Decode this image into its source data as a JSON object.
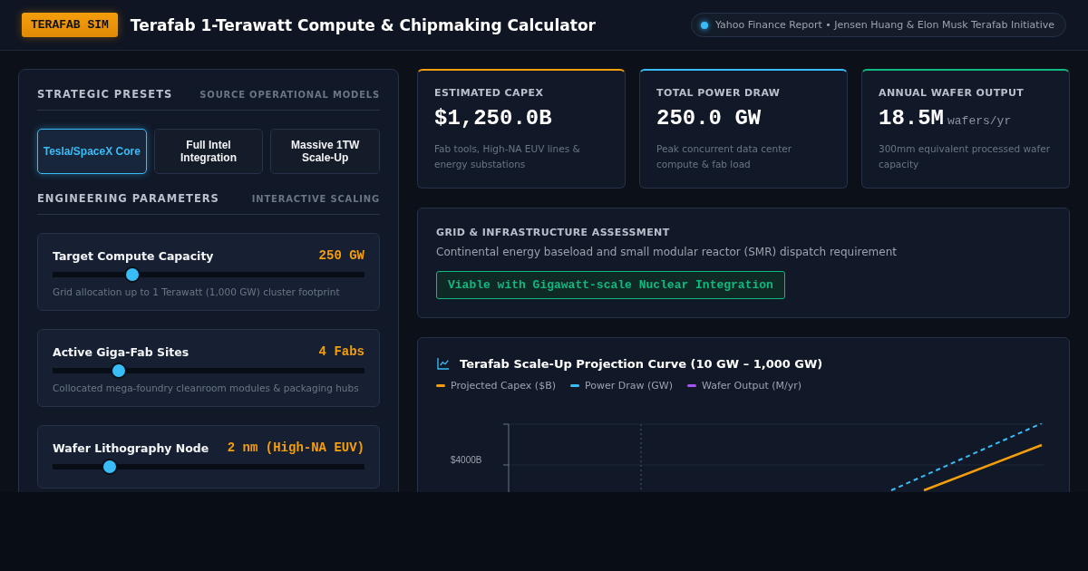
{
  "header": {
    "badge": "TERAFAB SIM",
    "title": "Terafab 1-Terawatt Compute & Chipmaking Calculator",
    "source": "Yahoo Finance Report • Jensen Huang & Elon Musk Terafab Initiative"
  },
  "presets": {
    "title": "STRATEGIC PRESETS",
    "subtitle": "SOURCE OPERATIONAL MODELS",
    "items": [
      {
        "label": "Tesla/SpaceX Core",
        "selected": true
      },
      {
        "label": "Full Intel Integration",
        "selected": false
      },
      {
        "label": "Massive 1TW Scale-Up",
        "selected": false
      }
    ]
  },
  "parameters": {
    "title": "ENGINEERING PARAMETERS",
    "subtitle": "INTERACTIVE SCALING",
    "items": [
      {
        "label": "Target Compute Capacity",
        "value": "250 GW",
        "level": 0.256,
        "hint": "Grid allocation up to 1 Terawatt (1,000 GW) cluster footprint"
      },
      {
        "label": "Active Giga-Fab Sites",
        "value": "4 Fabs",
        "level": 0.212,
        "hint": "Collocated mega-foundry cleanroom modules & packaging hubs"
      },
      {
        "label": "Wafer Lithography Node",
        "value": "2 nm (High-NA EUV)",
        "level": 0.183
      }
    ]
  },
  "metrics": [
    {
      "label": "ESTIMATED CAPEX",
      "value": "$1,250.0B",
      "color": "#f59e0b",
      "note": "Fab tools, High-NA EUV lines & energy substations"
    },
    {
      "label": "TOTAL POWER DRAW",
      "value": "250.0 GW",
      "color": "#38bdf8",
      "note": "Peak concurrent data center compute & fab load"
    },
    {
      "label": "ANNUAL WAFER OUTPUT",
      "value": "18.5M",
      "unit": "wafers/yr",
      "color": "#10b981",
      "note": "300mm equivalent processed wafer capacity"
    }
  ],
  "grid": {
    "title": "GRID & INFRASTRUCTURE ASSESSMENT",
    "text": "Continental energy baseload and small modular reactor (SMR) dispatch requirement",
    "verdict": "Viable with Gigawatt-scale Nuclear Integration"
  },
  "projection": {
    "title": "Terafab Scale-Up Projection Curve (10 GW – 1,000 GW)",
    "legend": [
      {
        "label": "Projected Capex ($B)",
        "color": "#f59e0b"
      },
      {
        "label": "Power Draw (GW)",
        "color": "#38bdf8"
      },
      {
        "label": "Wafer Output (M/yr)",
        "color": "#a855f7"
      }
    ],
    "y_tick_label": "$4000B"
  }
}
